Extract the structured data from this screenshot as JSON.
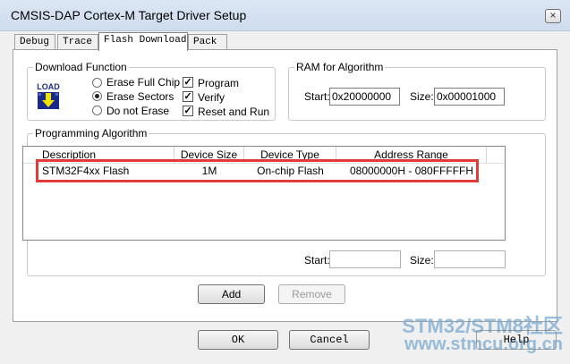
{
  "window": {
    "title": "CMSIS-DAP Cortex-M Target Driver Setup",
    "close_glyph": "×"
  },
  "tabs": [
    {
      "label": "Debug"
    },
    {
      "label": "Trace"
    },
    {
      "label": "Flash Download"
    },
    {
      "label": "Pack"
    }
  ],
  "download_function": {
    "title": "Download Function",
    "icon_text": "LOAD",
    "radios": [
      {
        "label": "Erase Full Chip",
        "checked": false
      },
      {
        "label": "Erase Sectors",
        "checked": true
      },
      {
        "label": "Do not Erase",
        "checked": false
      }
    ],
    "checkboxes": [
      {
        "label": "Program",
        "checked": true
      },
      {
        "label": "Verify",
        "checked": true
      },
      {
        "label": "Reset and Run",
        "checked": true
      }
    ],
    "check_glyph": "✓"
  },
  "ram": {
    "title": "RAM for Algorithm",
    "start_label": "Start:",
    "start_value": "0x20000000",
    "size_label": "Size:",
    "size_value": "0x00001000"
  },
  "programming": {
    "title": "Programming Algorithm",
    "columns": [
      "Description",
      "Device Size",
      "Device Type",
      "Address Range"
    ],
    "rows": [
      [
        "STM32F4xx Flash",
        "1M",
        "On-chip Flash",
        "08000000H - 080FFFFFH"
      ]
    ],
    "start_label": "Start:",
    "start_value": "",
    "size_label": "Size:",
    "size_value": ""
  },
  "buttons": {
    "add": "Add",
    "remove": "Remove",
    "ok": "OK",
    "cancel": "Cancel",
    "help": "Help"
  },
  "watermark": {
    "line1": "STM32/STM8社区",
    "line2": "www.stmcu.org.cn"
  },
  "colors": {
    "highlight": "#e03a3a"
  }
}
